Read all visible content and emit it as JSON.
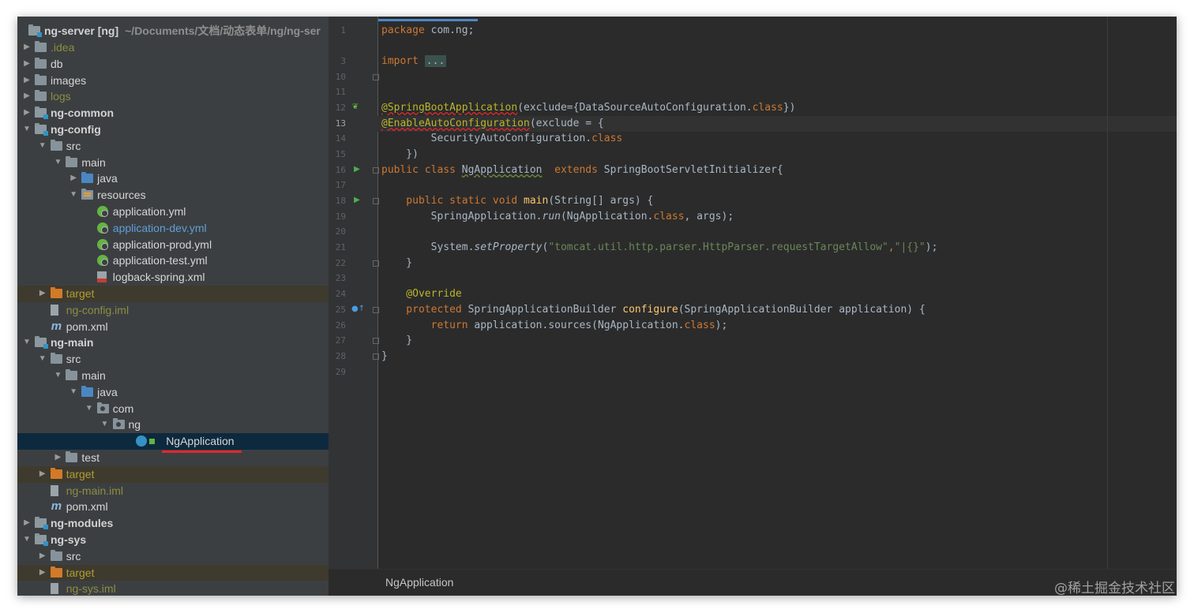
{
  "tree": {
    "root": {
      "name": "ng-server [ng]",
      "path": "~/Documents/文档/动态表单/ng/ng-ser"
    },
    "rows": [
      {
        "label": ".idea",
        "depth": 1,
        "arrow": "▶",
        "icon": "folder",
        "color": "olive"
      },
      {
        "label": "db",
        "depth": 1,
        "arrow": "▶",
        "icon": "folder",
        "color": "white"
      },
      {
        "label": "images",
        "depth": 1,
        "arrow": "▶",
        "icon": "folder",
        "color": "white"
      },
      {
        "label": "logs",
        "depth": 1,
        "arrow": "▶",
        "icon": "folder",
        "color": "olive"
      },
      {
        "label": "ng-common",
        "depth": 1,
        "arrow": "▶",
        "icon": "module",
        "color": "bold"
      },
      {
        "label": "ng-config",
        "depth": 1,
        "arrow": "▼",
        "icon": "module",
        "color": "bold"
      },
      {
        "label": "src",
        "depth": 2,
        "arrow": "▼",
        "icon": "folder",
        "color": "white"
      },
      {
        "label": "main",
        "depth": 3,
        "arrow": "▼",
        "icon": "folder",
        "color": "white"
      },
      {
        "label": "java",
        "depth": 4,
        "arrow": "▶",
        "icon": "folder-blue",
        "color": "white"
      },
      {
        "label": "resources",
        "depth": 4,
        "arrow": "▼",
        "icon": "folder-res",
        "color": "white"
      },
      {
        "label": "application.yml",
        "depth": 5,
        "arrow": "",
        "icon": "spring",
        "color": "white"
      },
      {
        "label": "application-dev.yml",
        "depth": 5,
        "arrow": "",
        "icon": "spring",
        "color": "blue"
      },
      {
        "label": "application-prod.yml",
        "depth": 5,
        "arrow": "",
        "icon": "spring",
        "color": "white"
      },
      {
        "label": "application-test.yml",
        "depth": 5,
        "arrow": "",
        "icon": "spring",
        "color": "white"
      },
      {
        "label": "logback-spring.xml",
        "depth": 5,
        "arrow": "",
        "icon": "xml",
        "color": "white"
      },
      {
        "label": "target",
        "depth": 2,
        "arrow": "▶",
        "icon": "folder-orange",
        "color": "yellow",
        "excluded": true
      },
      {
        "label": "ng-config.iml",
        "depth": 2,
        "arrow": "",
        "icon": "iml",
        "color": "olive"
      },
      {
        "label": "pom.xml",
        "depth": 2,
        "arrow": "",
        "icon": "maven",
        "color": "white"
      },
      {
        "label": "ng-main",
        "depth": 1,
        "arrow": "▼",
        "icon": "module",
        "color": "bold"
      },
      {
        "label": "src",
        "depth": 2,
        "arrow": "▼",
        "icon": "folder",
        "color": "white"
      },
      {
        "label": "main",
        "depth": 3,
        "arrow": "▼",
        "icon": "folder",
        "color": "white"
      },
      {
        "label": "java",
        "depth": 4,
        "arrow": "▼",
        "icon": "folder-blue",
        "color": "white"
      },
      {
        "label": "com",
        "depth": 5,
        "arrow": "▼",
        "icon": "pkg",
        "color": "white"
      },
      {
        "label": "ng",
        "depth": 6,
        "arrow": "▼",
        "icon": "pkg",
        "color": "white"
      },
      {
        "label": "NgApplication",
        "depth": 7,
        "arrow": "",
        "icon": "class",
        "color": "white",
        "selected": true
      },
      {
        "label": "test",
        "depth": 3,
        "arrow": "▶",
        "icon": "folder",
        "color": "white"
      },
      {
        "label": "target",
        "depth": 2,
        "arrow": "▶",
        "icon": "folder-orange",
        "color": "yellow",
        "excluded": true
      },
      {
        "label": "ng-main.iml",
        "depth": 2,
        "arrow": "",
        "icon": "iml",
        "color": "olive"
      },
      {
        "label": "pom.xml",
        "depth": 2,
        "arrow": "",
        "icon": "maven",
        "color": "white"
      },
      {
        "label": "ng-modules",
        "depth": 1,
        "arrow": "▶",
        "icon": "module",
        "color": "bold"
      },
      {
        "label": "ng-sys",
        "depth": 1,
        "arrow": "▼",
        "icon": "module",
        "color": "bold"
      },
      {
        "label": "src",
        "depth": 2,
        "arrow": "▶",
        "icon": "folder",
        "color": "white"
      },
      {
        "label": "target",
        "depth": 2,
        "arrow": "▶",
        "icon": "folder-orange",
        "color": "yellow",
        "excluded": true
      },
      {
        "label": "ng-sys.iml",
        "depth": 2,
        "arrow": "",
        "icon": "iml",
        "color": "olive"
      }
    ]
  },
  "editor": {
    "line_numbers": [
      "1",
      "3",
      "10",
      "11",
      "12",
      "13",
      "14",
      "15",
      "16",
      "17",
      "18",
      "19",
      "20",
      "21",
      "22",
      "23",
      "24",
      "25",
      "26",
      "27",
      "28",
      "29"
    ],
    "current_line": "13",
    "code": {
      "l1_kw": "package",
      "l1_rest": " com.ng;",
      "l3_kw": "import",
      "l3_fold": "...",
      "l12_ann": "@SpringBootApplication",
      "l12_rest": "(exclude={DataSourceAutoConfiguration.",
      "l12_cls": "class",
      "l12_end": "})",
      "l13_ann": "@EnableAutoConfiguration",
      "l13_rest": "(exclude = {",
      "l14_name": "        SecurityAutoConfiguration.",
      "l14_cls": "class",
      "l15": "    })",
      "l16_kw": "public class",
      "l16_name": "NgApplication",
      "l16_ext": "extends",
      "l16_rest": " SpringBootServletInitializer{",
      "l18_kw": "    public static void",
      "l18_fn": "main",
      "l18_rest": "(String[] args) {",
      "l19_a": "        SpringApplication.",
      "l19_run": "run",
      "l19_b": "(NgApplication.",
      "l19_cls": "class",
      "l19_c": ", args);",
      "l21_a": "        System.",
      "l21_fn": "setProperty",
      "l21_s1": "\"tomcat.util.http.parser.HttpParser.requestTargetAllow\"",
      "l21_comma": ",",
      "l21_s2": "\"|{}\"",
      "l21_end": ");",
      "l22": "    }",
      "l24_ann": "    @Override",
      "l25_kw": "    protected",
      "l25_type": " SpringApplicationBuilder ",
      "l25_fn": "configure",
      "l25_rest": "(SpringApplicationBuilder application) {",
      "l26_kw": "        return",
      "l26_rest": " application.sources(NgApplication.",
      "l26_cls": "class",
      "l26_end": ");",
      "l27": "    }",
      "l28": "}"
    },
    "breadcrumb": "NgApplication"
  },
  "watermark": "@稀土掘金技术社区",
  "colors": {
    "keyword": "#cc7832",
    "annotation": "#bbb529",
    "string": "#6a8759",
    "function": "#ffc66d",
    "text": "#a9b7c6",
    "selection": "#0d293e"
  }
}
